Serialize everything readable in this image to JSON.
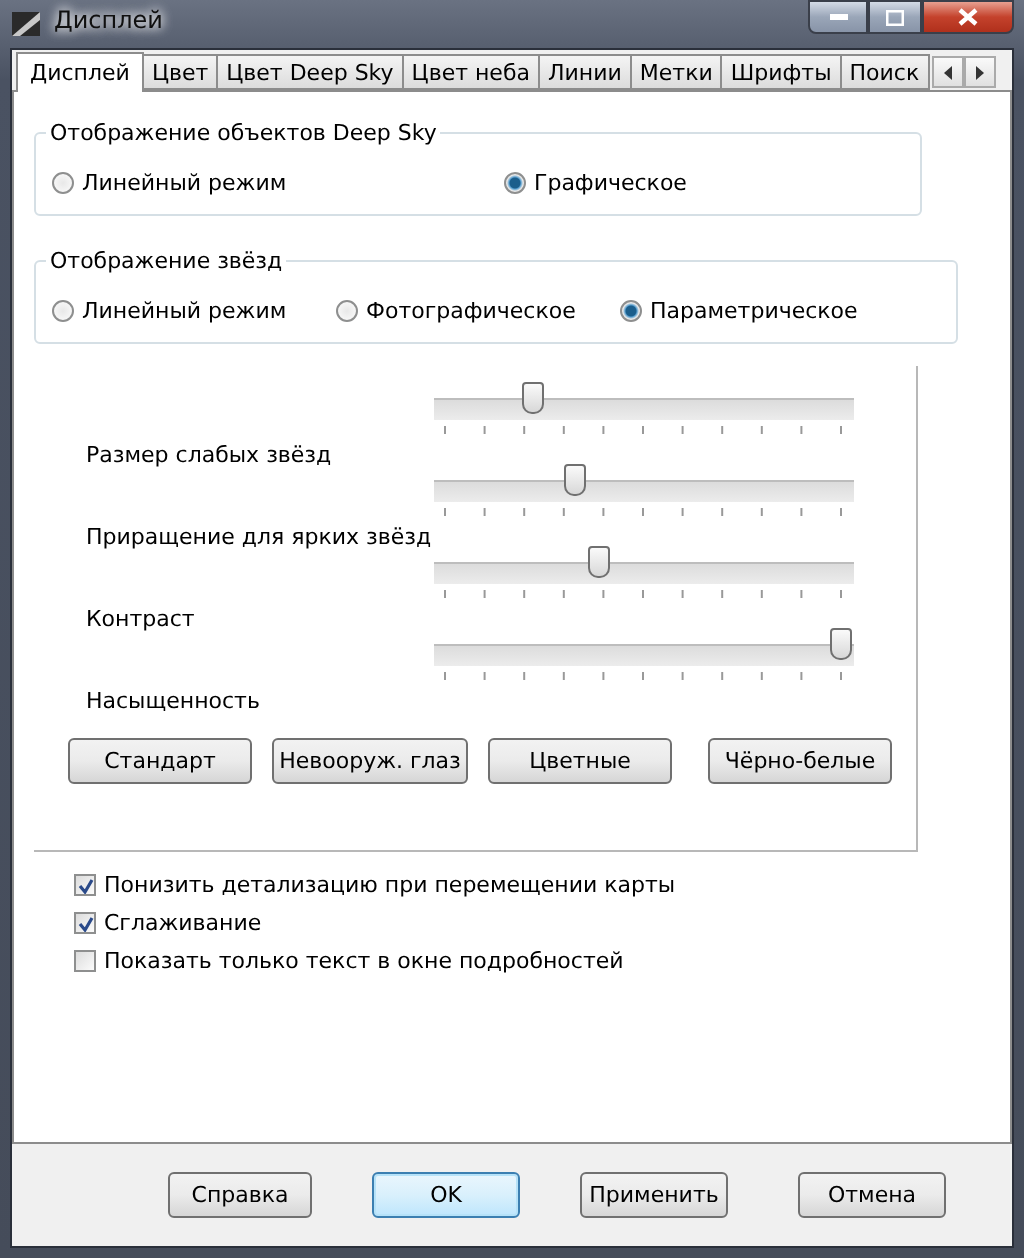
{
  "window": {
    "title": "Дисплей"
  },
  "tabs": [
    {
      "label": "Дисплей",
      "selected": true
    },
    {
      "label": "Цвет",
      "selected": false
    },
    {
      "label": "Цвет Deep Sky",
      "selected": false
    },
    {
      "label": "Цвет неба",
      "selected": false
    },
    {
      "label": "Линии",
      "selected": false
    },
    {
      "label": "Метки",
      "selected": false
    },
    {
      "label": "Шрифты",
      "selected": false
    },
    {
      "label": "Поиск",
      "selected": false
    }
  ],
  "groups": [
    {
      "title": "Отображение объектов Deep Sky",
      "options": [
        {
          "label": "Линейный режим",
          "selected": false
        },
        {
          "label": "Графическое",
          "selected": true
        }
      ]
    },
    {
      "title": "Отображение звёзд",
      "options": [
        {
          "label": "Линейный режим",
          "selected": false
        },
        {
          "label": "Фотографическое",
          "selected": false
        },
        {
          "label": "Параметрическое",
          "selected": true
        }
      ]
    }
  ],
  "sliders": [
    {
      "label": "Размер слабых звёзд",
      "level": 0.22
    },
    {
      "label": "Приращение для ярких звёзд",
      "level": 0.33
    },
    {
      "label": "Контраст",
      "level": 0.39
    },
    {
      "label": "Насыщенность",
      "level": 1.0
    }
  ],
  "presets": [
    "Стандарт",
    "Невооруж. глаз",
    "Цветные",
    "Чёрно-белые"
  ],
  "checkboxes": [
    {
      "label": "Понизить детализацию при перемещении карты",
      "checked": true
    },
    {
      "label": "Сглаживание",
      "checked": true
    },
    {
      "label": "Показать только текст в окне подробностей",
      "checked": false
    }
  ],
  "buttons": [
    {
      "label": "Справка",
      "default": false
    },
    {
      "label": "OK",
      "default": true
    },
    {
      "label": "Применить",
      "default": false
    },
    {
      "label": "Отмена",
      "default": false
    }
  ]
}
